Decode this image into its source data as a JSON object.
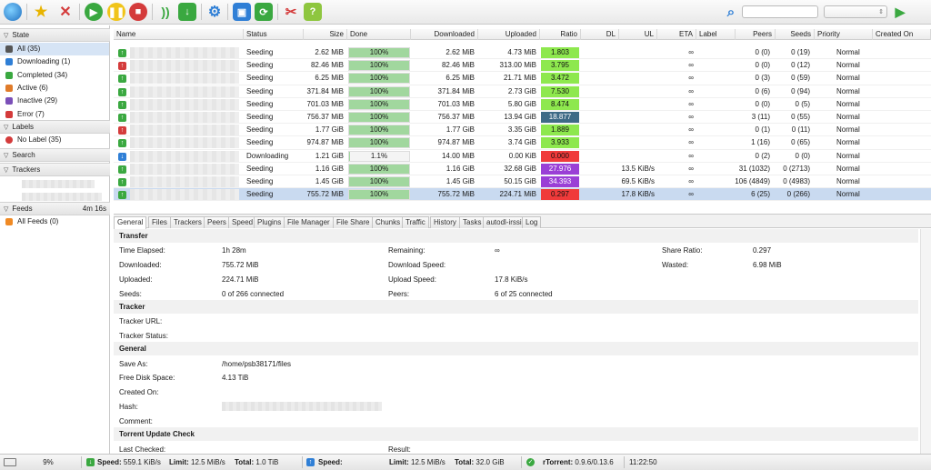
{
  "colors": {
    "accent_blue": "#2f7fd6",
    "seed_green": "#3aa840",
    "error_red": "#d43b3b",
    "ratio_green": "#8ee84e",
    "ratio_dark": "#3e6b86",
    "ratio_red": "#f03a3a",
    "ratio_purple": "#9a3fd6",
    "done_green": "#a1d79e",
    "selected_row": "#c9daf0"
  },
  "toolbar": {
    "icons": [
      "globe-icon",
      "star-icon",
      "remove-icon",
      "start-icon",
      "pause-icon",
      "stop-icon",
      "rss-icon",
      "download-icon",
      "settings-icon",
      "window-icon",
      "refresh-icon",
      "tools-icon",
      "help-icon",
      "search-icon",
      "play-icon"
    ],
    "help_label": "?",
    "play_label": "▶",
    "search_label": "⌕"
  },
  "sidebar": {
    "state_title": "State",
    "state_items": [
      {
        "label": "All (35)",
        "icon": "all-icon",
        "color": "#555555"
      },
      {
        "label": "Downloading (1)",
        "icon": "downloading-icon",
        "color": "#2f7fd6"
      },
      {
        "label": "Completed (34)",
        "icon": "completed-icon",
        "color": "#3aa840"
      },
      {
        "label": "Active (6)",
        "icon": "active-icon",
        "color": "#e07b2a"
      },
      {
        "label": "Inactive (29)",
        "icon": "inactive-icon",
        "color": "#7b4fb8"
      },
      {
        "label": "Error (7)",
        "icon": "error-icon",
        "color": "#d43b3b"
      }
    ],
    "labels_title": "Labels",
    "label_items": [
      {
        "label": "No Label (35)",
        "icon": "no-label-icon"
      }
    ],
    "search_title": "Search",
    "trackers_title": "Trackers",
    "feeds_title": "Feeds",
    "feeds_time": "4m 16s",
    "feed_items": [
      {
        "label": "All Feeds (0)",
        "icon": "rss-icon"
      }
    ]
  },
  "list": {
    "columns": [
      "Name",
      "Status",
      "Size",
      "Done",
      "Downloaded",
      "Uploaded",
      "Ratio",
      "DL",
      "UL",
      "ETA",
      "Label",
      "Peers",
      "Seeds",
      "Priority",
      "Created On"
    ],
    "rows": [
      {
        "icon": "green",
        "status": "Seeding",
        "size": "2.62 MiB",
        "done": "100%",
        "done_frac": 1.0,
        "downloaded": "2.62 MiB",
        "uploaded": "4.73 MiB",
        "ratio": "1.803",
        "ratio_color": "#8ee84e",
        "dl": "",
        "ul": "",
        "eta": "∞",
        "peers": "0 (0)",
        "seeds": "0 (19)",
        "priority": "Normal"
      },
      {
        "icon": "red",
        "status": "Seeding",
        "size": "82.46 MiB",
        "done": "100%",
        "done_frac": 1.0,
        "downloaded": "82.46 MiB",
        "uploaded": "313.00 MiB",
        "ratio": "3.795",
        "ratio_color": "#8ee84e",
        "dl": "",
        "ul": "",
        "eta": "∞",
        "peers": "0 (0)",
        "seeds": "0 (12)",
        "priority": "Normal"
      },
      {
        "icon": "green",
        "status": "Seeding",
        "size": "6.25 MiB",
        "done": "100%",
        "done_frac": 1.0,
        "downloaded": "6.25 MiB",
        "uploaded": "21.71 MiB",
        "ratio": "3.472",
        "ratio_color": "#8ee84e",
        "dl": "",
        "ul": "",
        "eta": "∞",
        "peers": "0 (3)",
        "seeds": "0 (59)",
        "priority": "Normal"
      },
      {
        "icon": "green",
        "status": "Seeding",
        "size": "371.84 MiB",
        "done": "100%",
        "done_frac": 1.0,
        "downloaded": "371.84 MiB",
        "uploaded": "2.73 GiB",
        "ratio": "7.530",
        "ratio_color": "#8ee84e",
        "dl": "",
        "ul": "",
        "eta": "∞",
        "peers": "0 (6)",
        "seeds": "0 (94)",
        "priority": "Normal"
      },
      {
        "icon": "green",
        "status": "Seeding",
        "size": "701.03 MiB",
        "done": "100%",
        "done_frac": 1.0,
        "downloaded": "701.03 MiB",
        "uploaded": "5.80 GiB",
        "ratio": "8.474",
        "ratio_color": "#8ee84e",
        "dl": "",
        "ul": "",
        "eta": "∞",
        "peers": "0 (0)",
        "seeds": "0 (5)",
        "priority": "Normal"
      },
      {
        "icon": "green",
        "status": "Seeding",
        "size": "756.37 MiB",
        "done": "100%",
        "done_frac": 1.0,
        "downloaded": "756.37 MiB",
        "uploaded": "13.94 GiB",
        "ratio": "18.877",
        "ratio_color": "#3e6b86",
        "dl": "",
        "ul": "",
        "eta": "∞",
        "peers": "3 (11)",
        "seeds": "0 (55)",
        "priority": "Normal"
      },
      {
        "icon": "red",
        "status": "Seeding",
        "size": "1.77 GiB",
        "done": "100%",
        "done_frac": 1.0,
        "downloaded": "1.77 GiB",
        "uploaded": "3.35 GiB",
        "ratio": "1.889",
        "ratio_color": "#8ee84e",
        "dl": "",
        "ul": "",
        "eta": "∞",
        "peers": "0 (1)",
        "seeds": "0 (11)",
        "priority": "Normal"
      },
      {
        "icon": "green",
        "status": "Seeding",
        "size": "974.87 MiB",
        "done": "100%",
        "done_frac": 1.0,
        "downloaded": "974.87 MiB",
        "uploaded": "3.74 GiB",
        "ratio": "3.933",
        "ratio_color": "#8ee84e",
        "dl": "",
        "ul": "",
        "eta": "∞",
        "peers": "1 (16)",
        "seeds": "0 (65)",
        "priority": "Normal"
      },
      {
        "icon": "blue",
        "status": "Downloading",
        "size": "1.21 GiB",
        "done": "1.1%",
        "done_frac": 0.011,
        "downloaded": "14.00 MiB",
        "uploaded": "0.00 KiB",
        "ratio": "0.000",
        "ratio_color": "#f03a3a",
        "dl": "",
        "ul": "",
        "eta": "∞",
        "peers": "0 (2)",
        "seeds": "0 (0)",
        "priority": "Normal"
      },
      {
        "icon": "green",
        "status": "Seeding",
        "size": "1.16 GiB",
        "done": "100%",
        "done_frac": 1.0,
        "downloaded": "1.16 GiB",
        "uploaded": "32.68 GiB",
        "ratio": "27.976",
        "ratio_color": "#9a3fd6",
        "dl": "",
        "ul": "13.5 KiB/s",
        "eta": "∞",
        "peers": "31 (1032)",
        "seeds": "0 (2713)",
        "priority": "Normal"
      },
      {
        "icon": "green",
        "status": "Seeding",
        "size": "1.45 GiB",
        "done": "100%",
        "done_frac": 1.0,
        "downloaded": "1.45 GiB",
        "uploaded": "50.15 GiB",
        "ratio": "34.393",
        "ratio_color": "#9a3fd6",
        "dl": "",
        "ul": "69.5 KiB/s",
        "eta": "∞",
        "peers": "106 (4849)",
        "seeds": "0 (4983)",
        "priority": "Normal"
      },
      {
        "icon": "green",
        "status": "Seeding",
        "size": "755.72 MiB",
        "done": "100%",
        "done_frac": 1.0,
        "downloaded": "755.72 MiB",
        "uploaded": "224.71 MiB",
        "ratio": "0.297",
        "ratio_color": "#f03a3a",
        "dl": "",
        "ul": "17.8 KiB/s",
        "eta": "∞",
        "peers": "6 (25)",
        "seeds": "0 (266)",
        "priority": "Normal",
        "selected": true
      }
    ]
  },
  "tabs": [
    "General",
    "Files",
    "Trackers",
    "Peers",
    "Speed",
    "Plugins",
    "File Manager",
    "File Share",
    "Chunks",
    "Traffic",
    "History",
    "Tasks",
    "autodl-irssi",
    "Log"
  ],
  "details": {
    "transfer_title": "Transfer",
    "time_elapsed_label": "Time Elapsed:",
    "time_elapsed": "1h 28m",
    "remaining_label": "Remaining:",
    "remaining": "∞",
    "share_ratio_label": "Share Ratio:",
    "share_ratio": "0.297",
    "downloaded_label": "Downloaded:",
    "downloaded": "755.72 MiB",
    "download_speed_label": "Download Speed:",
    "download_speed": "",
    "wasted_label": "Wasted:",
    "wasted": "6.98 MiB",
    "uploaded_label": "Uploaded:",
    "uploaded": "224.71 MiB",
    "upload_speed_label": "Upload Speed:",
    "upload_speed": "17.8 KiB/s",
    "seeds_label": "Seeds:",
    "seeds": "0 of 266 connected",
    "peers_label": "Peers:",
    "peers": "6 of 25 connected",
    "tracker_title": "Tracker",
    "tracker_url_label": "Tracker URL:",
    "tracker_url": "",
    "tracker_status_label": "Tracker Status:",
    "tracker_status": "",
    "general_title": "General",
    "save_as_label": "Save As:",
    "save_as": "/home/psb38171/files",
    "free_disk_label": "Free Disk Space:",
    "free_disk": "4.13 TiB",
    "created_on_label": "Created On:",
    "created_on": "",
    "hash_label": "Hash:",
    "comment_label": "Comment:",
    "comment": "",
    "tuc_title": "Torrent Update Check",
    "last_checked_label": "Last Checked:",
    "last_checked": "",
    "result_label": "Result:",
    "result": ""
  },
  "statusbar": {
    "disk_percent": "9%",
    "dl_speed_label": "Speed:",
    "dl_speed": "559.1 KiB/s",
    "dl_limit_label": "Limit:",
    "dl_limit": "12.5 MiB/s",
    "dl_total_label": "Total:",
    "dl_total": "1.0 TiB",
    "ul_speed_label": "Speed:",
    "ul_speed": "",
    "ul_limit_label": "Limit:",
    "ul_limit": "12.5 MiB/s",
    "ul_total_label": "Total:",
    "ul_total": "32.0 GiB",
    "client_label": "rTorrent:",
    "client": "0.9.6/0.13.6",
    "time": "11:22:50"
  }
}
